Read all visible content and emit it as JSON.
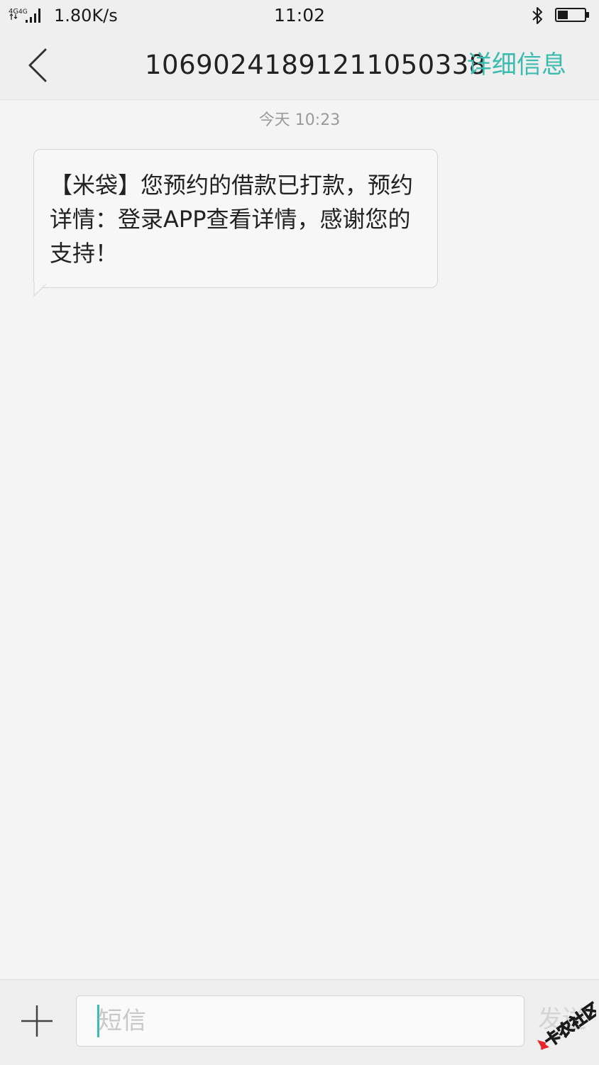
{
  "status_bar": {
    "network_label": "4G 4G",
    "speed": "1.80K/s",
    "time": "11:02",
    "battery_level_percent": 40
  },
  "header": {
    "contact": "106902418912110503​38",
    "details_label": "详细信息"
  },
  "conversation": {
    "timestamp": "今天  10:23",
    "messages": [
      {
        "direction": "incoming",
        "text": "【米袋】您预约的借款已打款，预约详情：登录APP查看详情，感谢您的支持！"
      }
    ]
  },
  "composer": {
    "placeholder": "短信",
    "value": "",
    "send_label": "发送"
  },
  "watermark": {
    "text": "卡农社区"
  },
  "colors": {
    "accent": "#3cbcae",
    "background": "#f4f4f4",
    "bar": "#efefef"
  },
  "icons": {
    "back": "chevron-left-icon",
    "add": "plus-icon",
    "bluetooth": "bluetooth-icon",
    "battery": "battery-icon",
    "signal": "signal-icon"
  }
}
